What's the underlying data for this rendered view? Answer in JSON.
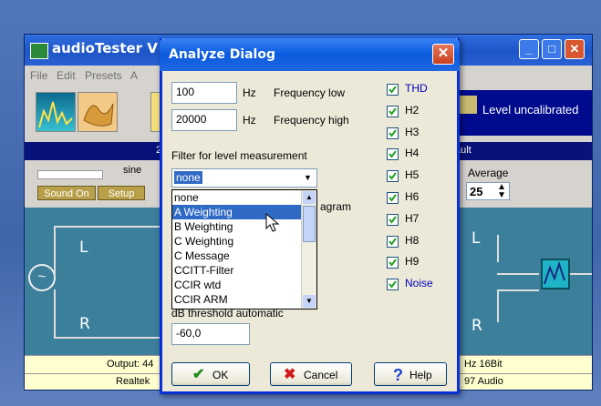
{
  "app": {
    "title": "audioTester  V",
    "menu": [
      "File",
      "Edit",
      "Presets",
      "A"
    ],
    "level_status": "Level uncalibrated",
    "band_left": "2",
    "band_right": "ault",
    "generator_label": "sine",
    "sound_on_button": "Sound On",
    "setup_button": "Setup",
    "average_label": "Average",
    "average_value": "25",
    "channel_left": "L",
    "channel_right": "R",
    "status_output_left": "Output: 44",
    "status_output_right": "Hz 16Bit",
    "status_device_left": "Realtek",
    "status_device_right": "97 Audio"
  },
  "dialog": {
    "title": "Analyze Dialog",
    "close_label": "✕",
    "freq_low_value": "100",
    "freq_low_unit": "Hz",
    "freq_low_label": "Frequency low",
    "freq_high_value": "20000",
    "freq_high_unit": "Hz",
    "freq_high_label": "Frequency high",
    "filter_label": "Filter for level measurement",
    "filter_selected": "none",
    "partial_label": "agram",
    "filter_options": [
      "none",
      "A Weighting",
      "B Weighting",
      "C Weighting",
      "C Message",
      "CCITT-Filter",
      "CCIR wtd",
      "CCIR ARM"
    ],
    "highlighted_option": "A Weighting",
    "threshold_label": "dB threshold automatic",
    "threshold_value": "-60,0",
    "checkboxes": [
      {
        "label": "THD",
        "checked": true,
        "color": "#0000c0"
      },
      {
        "label": "H2",
        "checked": true,
        "color": "#000000"
      },
      {
        "label": "H3",
        "checked": true,
        "color": "#000000"
      },
      {
        "label": "H4",
        "checked": true,
        "color": "#000000"
      },
      {
        "label": "H5",
        "checked": true,
        "color": "#000000"
      },
      {
        "label": "H6",
        "checked": true,
        "color": "#000000"
      },
      {
        "label": "H7",
        "checked": true,
        "color": "#000000"
      },
      {
        "label": "H8",
        "checked": true,
        "color": "#000000"
      },
      {
        "label": "H9",
        "checked": true,
        "color": "#000000"
      },
      {
        "label": "Noise",
        "checked": true,
        "color": "#0000c0"
      }
    ],
    "ok_label": "OK",
    "cancel_label": "Cancel",
    "help_label": "Help"
  }
}
